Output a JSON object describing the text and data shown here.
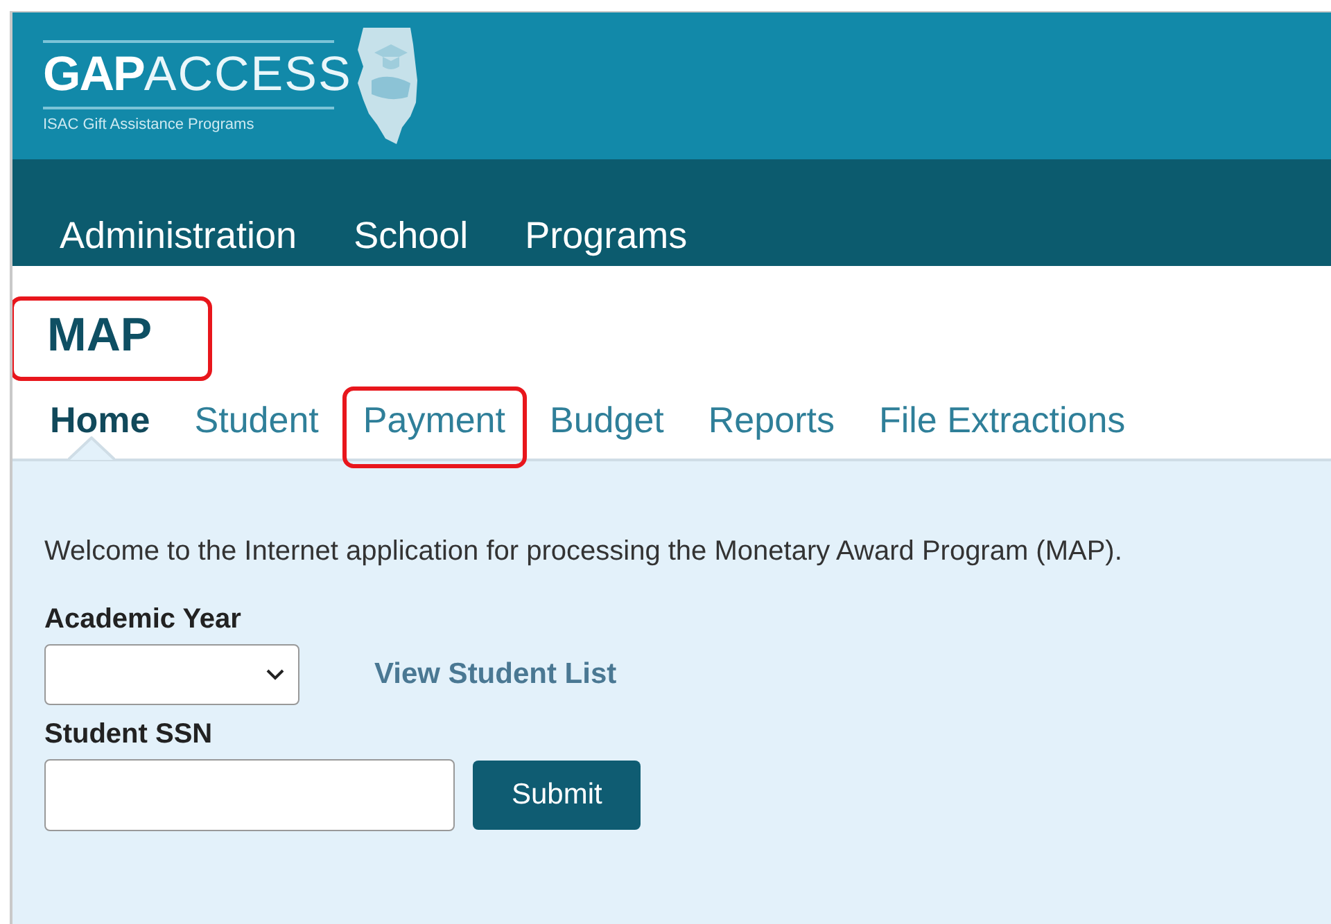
{
  "logo": {
    "word_bold": "GAP",
    "word_light": "ACCESS",
    "tagline": "ISAC Gift Assistance Programs"
  },
  "nav": [
    {
      "label": "Administration"
    },
    {
      "label": "School"
    },
    {
      "label": "Programs"
    }
  ],
  "page_title": {
    "text": "MAP",
    "highlighted": true
  },
  "tabs": [
    {
      "label": "Home",
      "selected": true,
      "highlighted": false
    },
    {
      "label": "Student",
      "selected": false,
      "highlighted": false
    },
    {
      "label": "Payment",
      "selected": false,
      "highlighted": true
    },
    {
      "label": "Budget",
      "selected": false,
      "highlighted": false
    },
    {
      "label": "Reports",
      "selected": false,
      "highlighted": false
    },
    {
      "label": "File Extractions",
      "selected": false,
      "highlighted": false
    }
  ],
  "welcome": "Welcome to the Internet application for processing the Monetary Award Program (MAP).",
  "academic_year": {
    "label": "Academic Year"
  },
  "view_link": "View Student List",
  "ssn": {
    "label": "Student SSN"
  },
  "submit": "Submit"
}
